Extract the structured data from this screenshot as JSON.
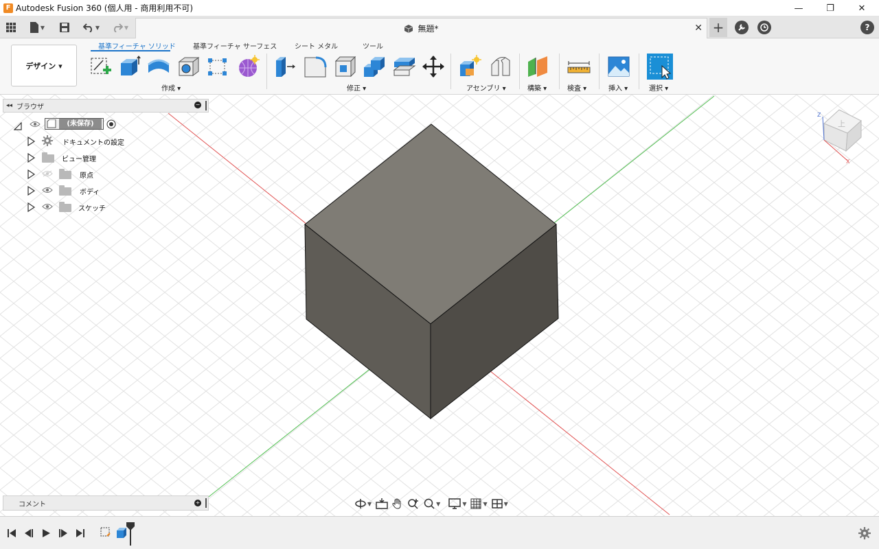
{
  "window": {
    "title": "Autodesk Fusion 360 (個人用 - 商用利用不可)",
    "logo_letter": "F",
    "minimize": "—",
    "maximize": "❐",
    "close": "✕"
  },
  "tabbar": {
    "doc_title": "無題*",
    "doc_close": "✕",
    "new_tab": "+",
    "help": "?"
  },
  "ribbon": {
    "workspace": "デザイン ▾",
    "tabs": [
      "基準フィーチャ ソリッド",
      "基準フィーチャ サーフェス",
      "シート メタル",
      "ツール"
    ],
    "groups": {
      "create": "作成 ▾",
      "modify": "修正 ▾",
      "assemble": "アセンブリ ▾",
      "construct": "構築 ▾",
      "inspect": "検査 ▾",
      "insert": "挿入 ▾",
      "select": "選択 ▾"
    }
  },
  "browser": {
    "title": "ブラウザ",
    "root": "(未保存)",
    "items": [
      {
        "label": "ドキュメントの設定",
        "icon": "gear-icon"
      },
      {
        "label": "ビュー管理",
        "icon": "folder-icon"
      },
      {
        "label": "原点",
        "icon": "folder-icon"
      },
      {
        "label": "ボディ",
        "icon": "folder-icon"
      },
      {
        "label": "スケッチ",
        "icon": "folder-icon"
      }
    ]
  },
  "comments": {
    "title": "コメント"
  },
  "viewcube": {
    "face": "上",
    "axis_x": "X",
    "axis_z": "Z"
  },
  "colors": {
    "accent": "#1a73c9",
    "cube_top": "#7f7c75",
    "cube_left": "#5f5c56",
    "cube_right": "#4f4c47",
    "axis_red": "#e05050",
    "axis_green": "#4fc04f"
  }
}
